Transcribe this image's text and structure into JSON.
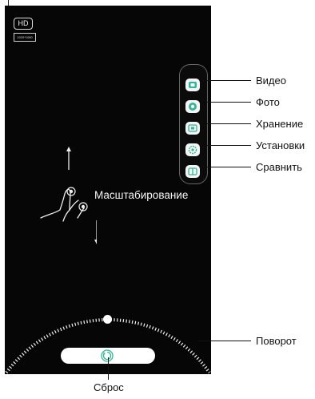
{
  "screen": {
    "hd_badge": "HD",
    "resolution_badge": "1920*1080",
    "zoom_gesture_label": "Масштабирование"
  },
  "side_menu": {
    "items": [
      {
        "label": "Видео",
        "icon": "video-icon"
      },
      {
        "label": "Фото",
        "icon": "photo-icon"
      },
      {
        "label": "Хранение",
        "icon": "storage-icon"
      },
      {
        "label": "Установки",
        "icon": "settings-icon"
      },
      {
        "label": "Сравнить",
        "icon": "compare-icon"
      }
    ]
  },
  "rotation": {
    "label": "Поворот"
  },
  "reset": {
    "label": "Сброс",
    "icon": "reset-icon"
  },
  "colors": {
    "screen_bg": "#060606",
    "accent_teal": "#2bb89a",
    "panel_border": "#666666"
  }
}
